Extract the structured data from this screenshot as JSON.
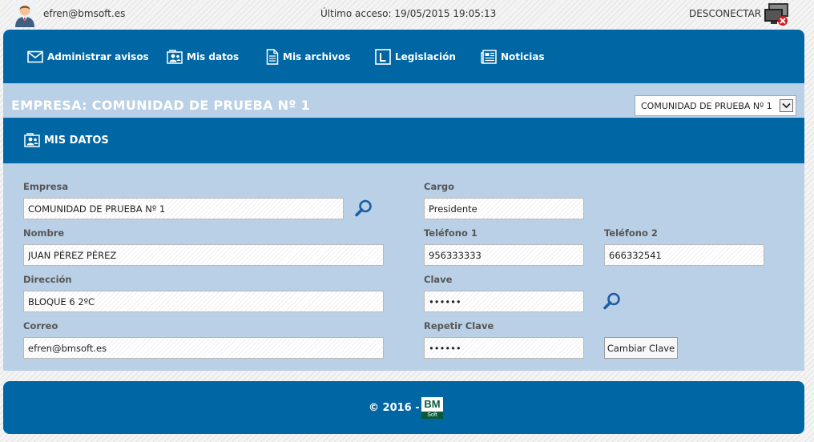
{
  "header": {
    "user_email": "efren@bmsoft.es",
    "last_access": "Último acceso: 19/05/2015 19:05:13",
    "disconnect_label": "DESCONECTAR",
    "avatar_icon": "user-avatar-icon",
    "disconnect_icon": "disconnect-computer-icon"
  },
  "nav": {
    "items": [
      {
        "label": "Administrar avisos",
        "icon": "envelope-icon"
      },
      {
        "label": "Mis datos",
        "icon": "user-card-icon"
      },
      {
        "label": "Mis archivos",
        "icon": "document-icon"
      },
      {
        "label": "Legislación",
        "icon": "legislation-icon"
      },
      {
        "label": "Noticias",
        "icon": "newspaper-icon"
      }
    ]
  },
  "company": {
    "title": "EMPRESA: COMUNIDAD DE PRUEBA Nº 1",
    "select_value": "COMUNIDAD DE PRUEBA Nº 1"
  },
  "section": {
    "title": "MIS DATOS",
    "icon": "user-card-icon"
  },
  "form": {
    "empresa": {
      "label": "Empresa",
      "value": "COMUNIDAD DE PRUEBA Nº 1"
    },
    "cargo": {
      "label": "Cargo",
      "value": "Presidente"
    },
    "nombre": {
      "label": "Nombre",
      "value": "JUAN PÉREZ PÉREZ"
    },
    "telefono1": {
      "label": "Teléfono 1",
      "value": "956333333"
    },
    "telefono2": {
      "label": "Teléfono 2",
      "value": "666332541"
    },
    "direccion": {
      "label": "Dirección",
      "value": "BLOQUE 6 2ºC"
    },
    "clave": {
      "label": "Clave",
      "value": "123456"
    },
    "correo": {
      "label": "Correo",
      "value": "efren@bmsoft.es"
    },
    "repetir_clave": {
      "label": "Repetir Clave",
      "value": "123456"
    },
    "change_password_label": "Cambiar Clave"
  },
  "footer": {
    "copyright": "© 2016 -",
    "logo_top": "BM",
    "logo_bottom": "Soft"
  },
  "colors": {
    "primary": "#0066a4",
    "panel": "#bad0e6",
    "search_icon": "#1c5fa8"
  }
}
